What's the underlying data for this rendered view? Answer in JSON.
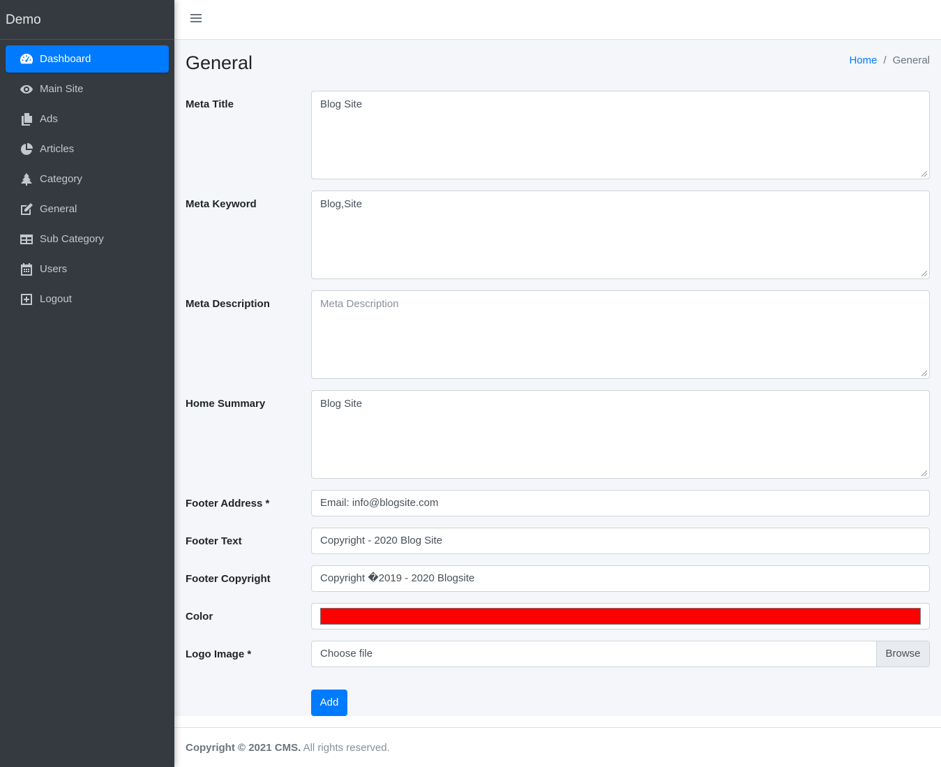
{
  "brand": "Demo",
  "sidebar": {
    "items": [
      {
        "label": "Dashboard",
        "icon": "dashboard-icon",
        "active": true
      },
      {
        "label": "Main Site",
        "icon": "eye-icon"
      },
      {
        "label": "Ads",
        "icon": "copy-icon"
      },
      {
        "label": "Articles",
        "icon": "pie-chart-icon"
      },
      {
        "label": "Category",
        "icon": "tree-icon"
      },
      {
        "label": "General",
        "icon": "edit-icon"
      },
      {
        "label": "Sub Category",
        "icon": "table-icon"
      },
      {
        "label": "Users",
        "icon": "calendar-icon"
      },
      {
        "label": "Logout",
        "icon": "plus-square-icon"
      }
    ]
  },
  "page": {
    "title": "General",
    "breadcrumb": {
      "home": "Home",
      "sep": "/",
      "current": "General"
    }
  },
  "form": {
    "meta_title": {
      "label": "Meta Title",
      "value": "Blog Site"
    },
    "meta_keyword": {
      "label": "Meta Keyword",
      "value": "Blog,Site"
    },
    "meta_description": {
      "label": "Meta Description",
      "value": "",
      "placeholder": "Meta Description"
    },
    "home_summary": {
      "label": "Home Summary",
      "value": "Blog Site"
    },
    "footer_address": {
      "label": "Footer Address *",
      "value": "Email: info@blogsite.com"
    },
    "footer_text": {
      "label": "Footer Text",
      "value": "Copyright - 2020 Blog Site"
    },
    "footer_copyright": {
      "label": "Footer Copyright",
      "value": "Copyright �2019 - 2020 Blogsite"
    },
    "color": {
      "label": "Color",
      "value": "#ff0000"
    },
    "logo_image": {
      "label": "Logo Image *",
      "value": "Choose file",
      "browse": "Browse"
    },
    "submit": "Add"
  },
  "footer": {
    "bold": "Copyright © 2021 CMS.",
    "rest": " All rights reserved."
  }
}
